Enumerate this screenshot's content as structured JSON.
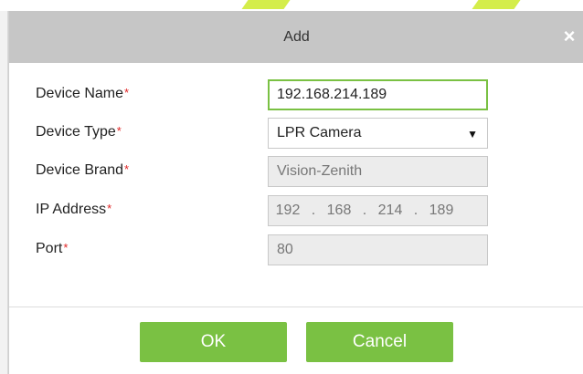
{
  "dialog": {
    "title": "Add",
    "close_glyph": "×"
  },
  "form": {
    "required_mark": "*",
    "device_name": {
      "label": "Device Name",
      "value": "192.168.214.189"
    },
    "device_type": {
      "label": "Device Type",
      "value": "LPR Camera",
      "arrow_glyph": "▼"
    },
    "device_brand": {
      "label": "Device Brand",
      "value": "Vision-Zenith"
    },
    "ip_address": {
      "label": "IP Address",
      "octets": [
        "192",
        "168",
        "214",
        "189"
      ],
      "separator": "."
    },
    "port": {
      "label": "Port",
      "value": "80"
    }
  },
  "buttons": {
    "ok": "OK",
    "cancel": "Cancel"
  },
  "colors": {
    "accent_green": "#7ac143",
    "titlebar": "#c6c6c6",
    "required_red": "#e02424",
    "disabled_field": "#ececec"
  }
}
